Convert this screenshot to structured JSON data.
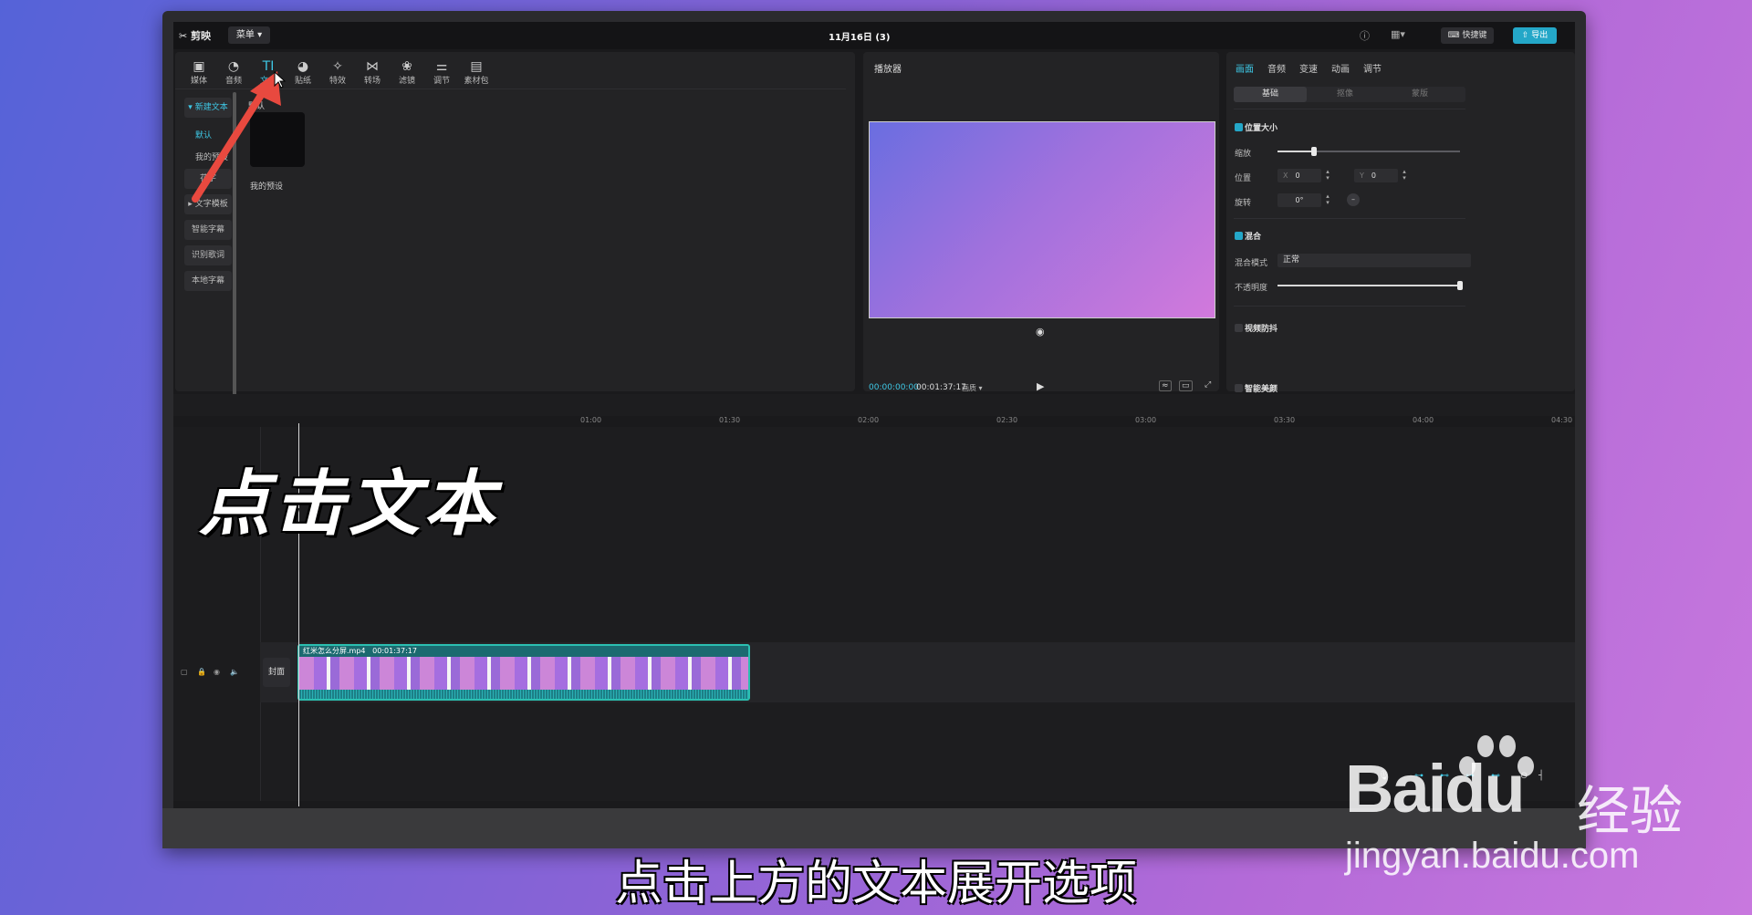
{
  "app": {
    "logo": "剪映",
    "menu": "菜单",
    "title": "11月16日 (3)",
    "shortcut": "快捷键",
    "export": "导出"
  },
  "toolbar": {
    "items": [
      {
        "icon": "media-icon",
        "label": "媒体",
        "glyph": "▣"
      },
      {
        "icon": "audio-icon",
        "label": "音频",
        "glyph": "◔"
      },
      {
        "icon": "text-icon",
        "label": "文本",
        "glyph": "TI"
      },
      {
        "icon": "sticker-icon",
        "label": "贴纸",
        "glyph": "◕"
      },
      {
        "icon": "effects-icon",
        "label": "特效",
        "glyph": "✧"
      },
      {
        "icon": "transition-icon",
        "label": "转场",
        "glyph": "⋈"
      },
      {
        "icon": "filter-icon",
        "label": "滤镜",
        "glyph": "❀"
      },
      {
        "icon": "adjust-icon",
        "label": "调节",
        "glyph": "⚌"
      },
      {
        "icon": "asset-pack-icon",
        "label": "素材包",
        "glyph": "▤"
      }
    ],
    "active": "文本"
  },
  "media_sidebar": {
    "new_text": "新建文本",
    "default": "默认",
    "my_presets": "我的预设",
    "flower_text": "花字",
    "text_templates": "文字模板",
    "smart_subtitles": "智能字幕",
    "lyrics": "识别歌词",
    "local_subtitles": "本地字幕",
    "crumb": "默认",
    "thumb_label": "我的预设"
  },
  "player": {
    "title": "播放器",
    "current_time": "00:00:00:00",
    "total_time": "00:01:37:17",
    "quality": "画质"
  },
  "inspector": {
    "tabs": [
      "画面",
      "音频",
      "变速",
      "动画",
      "调节"
    ],
    "segments": [
      "基础",
      "抠像",
      "蒙版"
    ],
    "position_size": "位置大小",
    "scale": "缩放",
    "position": "位置",
    "x_prefix": "X",
    "x_value": "0",
    "y_prefix": "Y",
    "y_value": "0",
    "rotate": "旋转",
    "rotate_value": "0°",
    "blend": "混合",
    "blend_mode": "混合模式",
    "blend_mode_value": "正常",
    "opacity": "不透明度",
    "stabilize": "视频防抖",
    "beautify": "智能美颜",
    "scale_level": 0.2,
    "opacity_level": 1.0
  },
  "timeline": {
    "ruler": [
      "01:00",
      "01:30",
      "02:00",
      "02:30",
      "03:00",
      "03:30",
      "04:00",
      "04:30"
    ],
    "cover": "封面",
    "clip_name": "红米怎么分屏.mp4",
    "clip_duration": "00:01:37:17"
  },
  "overlay": {
    "title": "点击文本",
    "subtitle": "点击上方的文本展开选项",
    "watermark_logo": "Baidu",
    "watermark_cn": "经验",
    "watermark_url": "jingyan.baidu.com"
  },
  "colors": {
    "accent": "#3ec8e6",
    "arrow": "#e8493f"
  }
}
